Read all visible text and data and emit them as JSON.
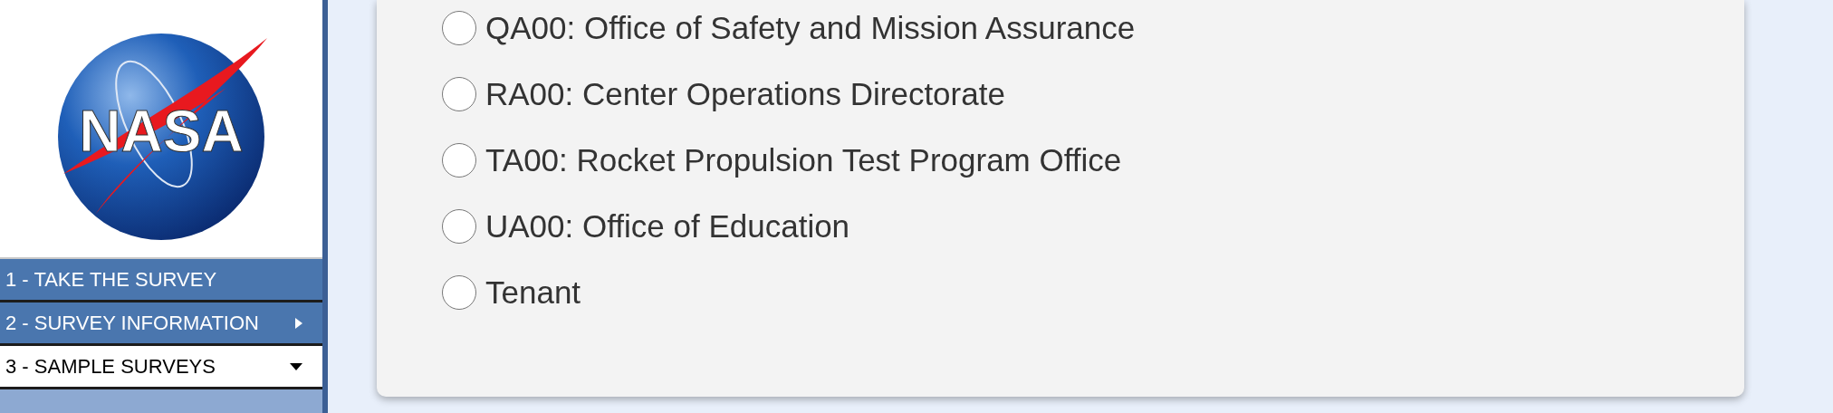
{
  "logo": {
    "text": "NASA"
  },
  "menu": [
    {
      "label": "1 - TAKE THE SURVEY",
      "kind": "link"
    },
    {
      "label": "2 - SURVEY INFORMATION",
      "kind": "submenu"
    },
    {
      "label": "3 - SAMPLE SURVEYS",
      "kind": "expanded"
    },
    {
      "kind": "child"
    }
  ],
  "options": [
    {
      "label": "QA00: Office of Safety and Mission Assurance",
      "selected": false
    },
    {
      "label": "RA00: Center Operations Directorate",
      "selected": false
    },
    {
      "label": "TA00: Rocket Propulsion Test Program Office",
      "selected": false
    },
    {
      "label": "UA00: Office of Education",
      "selected": false
    },
    {
      "label": "Tenant",
      "selected": false
    }
  ]
}
